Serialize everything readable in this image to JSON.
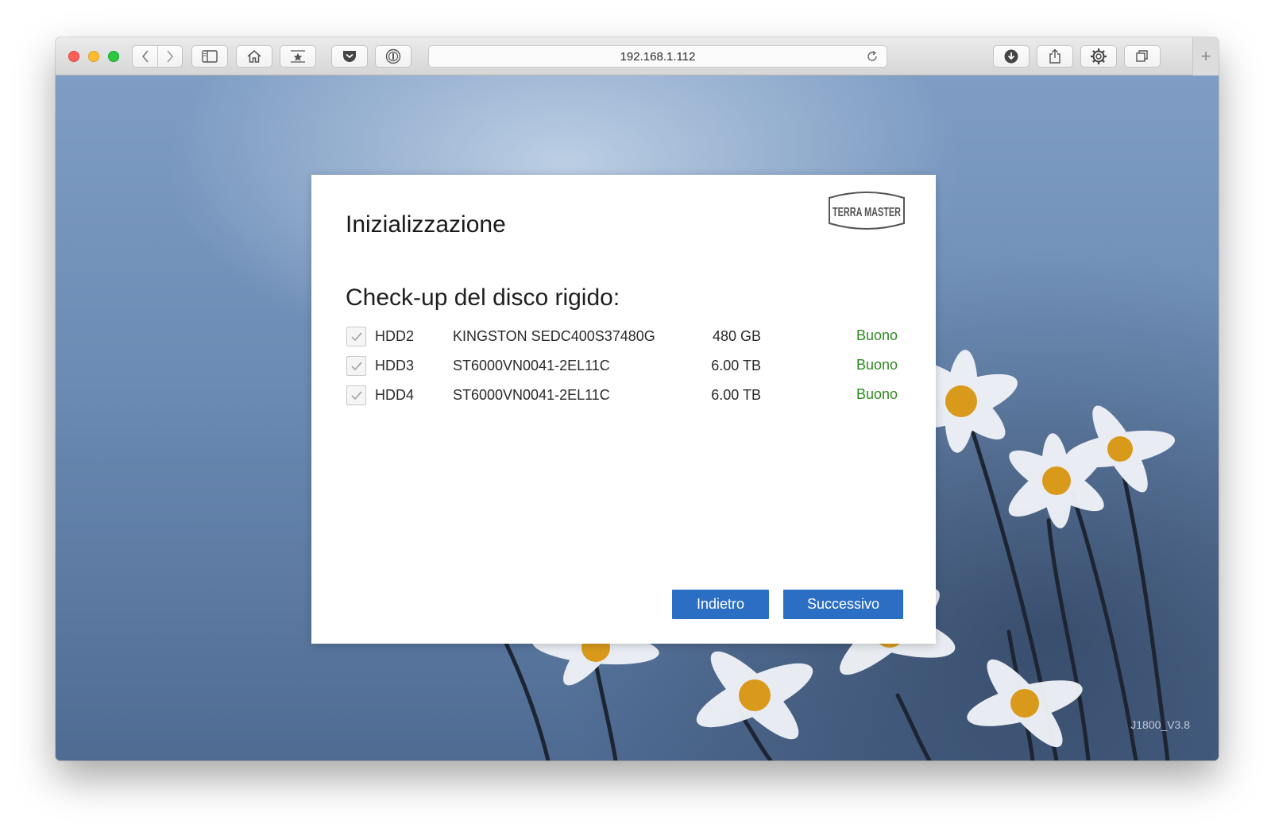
{
  "browser": {
    "address": "192.168.1.112",
    "new_tab_symbol": "+"
  },
  "dialog": {
    "title": "Inizializzazione",
    "logo_text": "TERRA MASTER",
    "section_title": "Check-up del disco rigido:",
    "disks": [
      {
        "slot": "HDD2",
        "model": "KINGSTON SEDC400S37480G",
        "size": "480 GB",
        "status": "Buono",
        "checked": true
      },
      {
        "slot": "HDD3",
        "model": "ST6000VN0041-2EL11C",
        "size": "6.00 TB",
        "status": "Buono",
        "checked": true
      },
      {
        "slot": "HDD4",
        "model": "ST6000VN0041-2EL11C",
        "size": "6.00 TB",
        "status": "Buono",
        "checked": true
      }
    ],
    "back_label": "Indietro",
    "next_label": "Successivo"
  },
  "version": "J1800_V3.8",
  "colors": {
    "button": "#2b6fc4",
    "status_good": "#2e8a1f"
  },
  "icons": [
    "close-window-icon",
    "minimize-window-icon",
    "zoom-window-icon",
    "chevron-left-icon",
    "chevron-right-icon",
    "sidebar-icon",
    "home-icon",
    "bookmark-star-icon",
    "pocket-icon",
    "password-manager-icon",
    "reload-icon",
    "download-icon",
    "share-icon",
    "gear-icon",
    "tabs-overview-icon",
    "checkmark-icon"
  ]
}
